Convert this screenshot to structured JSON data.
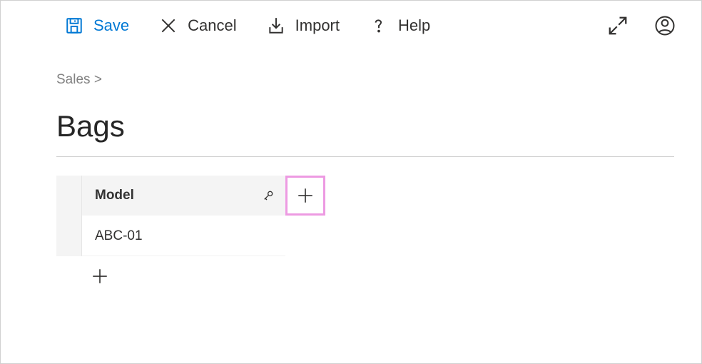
{
  "toolbar": {
    "save_label": "Save",
    "cancel_label": "Cancel",
    "import_label": "Import",
    "help_label": "Help"
  },
  "breadcrumb": {
    "parent": "Sales",
    "separator": ">"
  },
  "page": {
    "title": "Bags"
  },
  "table": {
    "column_header": "Model",
    "rows": [
      "ABC-01"
    ]
  },
  "colors": {
    "primary": "#0078d4",
    "highlight_border": "#ed9ae2"
  }
}
